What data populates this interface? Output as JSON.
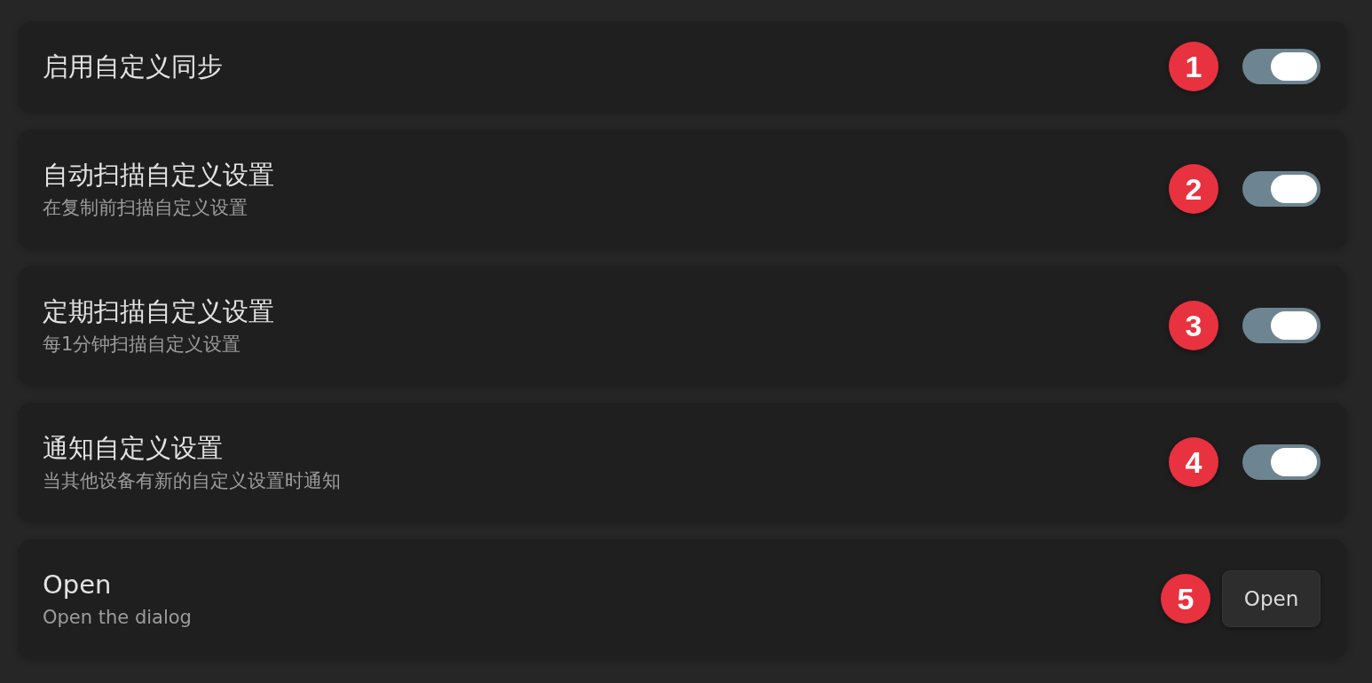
{
  "rows": [
    {
      "kind": "toggle",
      "title": "启用自定义同步",
      "checked": true,
      "badge": "1"
    },
    {
      "kind": "toggle",
      "title": "自动扫描自定义设置",
      "description": "在复制前扫描自定义设置",
      "checked": true,
      "badge": "2"
    },
    {
      "kind": "toggle",
      "title": "定期扫描自定义设置",
      "description": "每1分钟扫描自定义设置",
      "checked": true,
      "badge": "3"
    },
    {
      "kind": "toggle",
      "title": "通知自定义设置",
      "description": "当其他设备有新的自定义设置时通知",
      "checked": true,
      "badge": "4"
    },
    {
      "kind": "button",
      "title": "Open",
      "description": "Open the dialog",
      "button_label": "Open",
      "badge": "5"
    }
  ]
}
